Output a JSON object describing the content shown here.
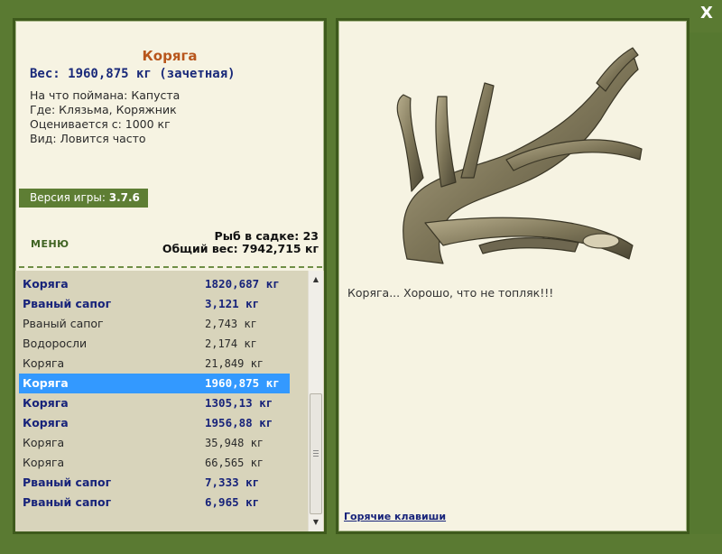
{
  "close_label": "X",
  "fish": {
    "name": "Коряга",
    "weight": "Вес: 1960,875 кг (зачетная)",
    "caught_on": "На что поймана: Капуста",
    "where": "Где: Клязьма, Коряжник",
    "valued_from": "Оценивается с: 1000 кг",
    "kind": "Вид: Ловится часто",
    "comment": "Коряга... Хорошо, что не топляк!!!"
  },
  "version": {
    "label": "Версия игры:",
    "value": "3.7.6"
  },
  "menu_label": "МЕНЮ",
  "stats": {
    "fish_in_keepnet": "Рыб в садке: 23",
    "total_weight": "Общий вес: 7942,715 кг"
  },
  "catch_list": [
    {
      "name": "Коряга",
      "weight": "1820,687 кг",
      "style": "bold"
    },
    {
      "name": "Рваный сапог",
      "weight": "3,121 кг",
      "style": "bold"
    },
    {
      "name": "Рваный сапог",
      "weight": "2,743 кг",
      "style": "plain"
    },
    {
      "name": "Водоросли",
      "weight": "2,174 кг",
      "style": "plain"
    },
    {
      "name": "Коряга",
      "weight": "21,849 кг",
      "style": "plain"
    },
    {
      "name": "Коряга",
      "weight": "1960,875 кг",
      "style": "selected"
    },
    {
      "name": "Коряга",
      "weight": "1305,13 кг",
      "style": "bold"
    },
    {
      "name": "Коряга",
      "weight": "1956,88 кг",
      "style": "bold"
    },
    {
      "name": "Коряга",
      "weight": "35,948 кг",
      "style": "plain"
    },
    {
      "name": "Коряга",
      "weight": "66,565 кг",
      "style": "plain"
    },
    {
      "name": "Рваный сапог",
      "weight": "7,333 кг",
      "style": "bold"
    },
    {
      "name": "Рваный сапог",
      "weight": "6,965 кг",
      "style": "bold"
    }
  ],
  "hotkeys_label": "Горячие клавиши",
  "icons": {
    "close": "close-icon",
    "scroll_up": "arrow-up-icon",
    "scroll_down": "arrow-down-icon"
  },
  "colors": {
    "frame": "#5a7a32",
    "panel": "#f6f3e2",
    "selected_row": "#3399ff",
    "title": "#b8561c",
    "bold_text": "#17237a"
  }
}
